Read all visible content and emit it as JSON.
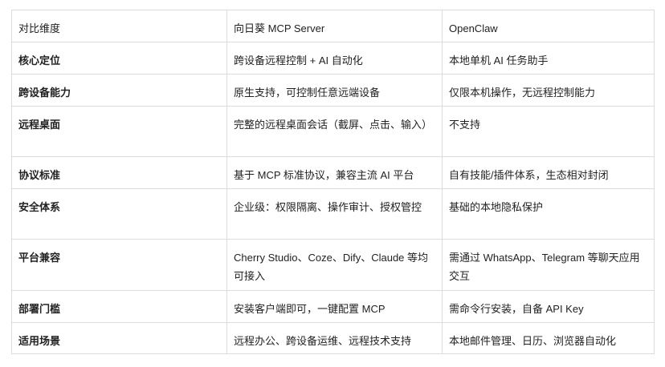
{
  "table": {
    "header": [
      "对比维度",
      "向日葵 MCP Server",
      "OpenClaw"
    ],
    "rows": [
      [
        "核心定位",
        "跨设备远程控制 + AI 自动化",
        "本地单机 AI 任务助手"
      ],
      [
        "跨设备能力",
        "原生支持，可控制任意远端设备",
        "仅限本机操作，无远程控制能力"
      ],
      [
        "远程桌面",
        "完整的远程桌面会话（截屏、点击、输入）",
        "不支持"
      ],
      [
        "协议标准",
        "基于 MCP 标准协议，兼容主流 AI 平台",
        "自有技能/插件体系，生态相对封闭"
      ],
      [
        "安全体系",
        "企业级：权限隔离、操作审计、授权管控",
        "基础的本地隐私保护"
      ],
      [
        "平台兼容",
        "Cherry Studio、Coze、Dify、Claude 等均可接入",
        "需通过 WhatsApp、Telegram 等聊天应用交互"
      ],
      [
        "部署门槛",
        "安装客户端即可，一键配置 MCP",
        "需命令行安装，自备 API Key"
      ],
      [
        "适用场景",
        "远程办公、跨设备运维、远程技术支持",
        "本地邮件管理、日历、浏览器自动化"
      ]
    ]
  }
}
